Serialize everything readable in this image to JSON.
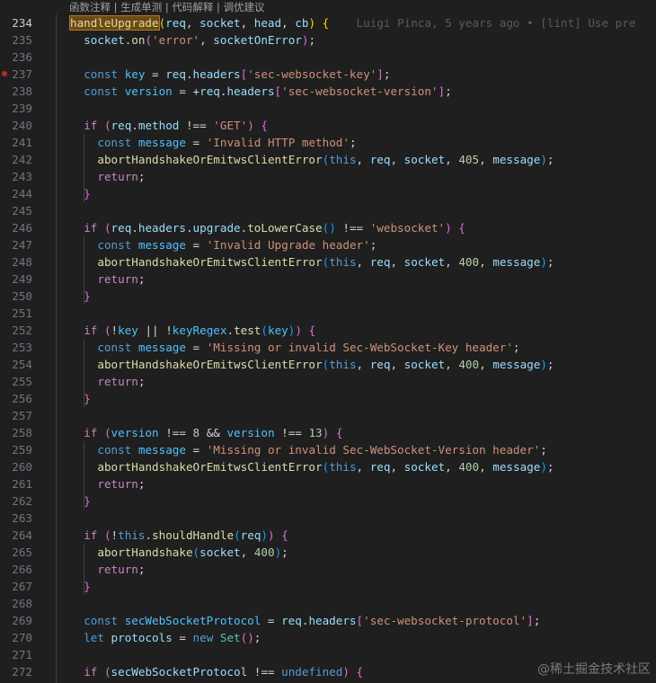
{
  "codelens": [
    {
      "label": "函数注释"
    },
    {
      "label": "生成单测"
    },
    {
      "label": "代码解释"
    },
    {
      "label": "调优建议"
    }
  ],
  "codelens_separator": " | ",
  "watermark": "@稀土掘金技术社区",
  "active_line": 234,
  "breakpoint_line": 237,
  "lines": [
    {
      "n": "234",
      "indent": 0,
      "blame": "Luigi Pinca, 5 years ago • [lint] Use pre",
      "tokens": [
        [
          "handleUpgrade",
          "fn hl"
        ],
        [
          "(",
          "br1"
        ],
        [
          "req",
          "var"
        ],
        [
          ", ",
          "plain"
        ],
        [
          "socket",
          "var"
        ],
        [
          ", ",
          "plain"
        ],
        [
          "head",
          "var"
        ],
        [
          ", ",
          "plain"
        ],
        [
          "cb",
          "var"
        ],
        [
          ")",
          "br1"
        ],
        [
          " {",
          "br1"
        ]
      ]
    },
    {
      "n": "235",
      "indent": 1,
      "tokens": [
        [
          "socket",
          "var"
        ],
        [
          ".",
          "plain"
        ],
        [
          "on",
          "fn"
        ],
        [
          "(",
          "br2"
        ],
        [
          "'error'",
          "str"
        ],
        [
          ", ",
          "plain"
        ],
        [
          "socketOnError",
          "var"
        ],
        [
          ")",
          "br2"
        ],
        [
          ";",
          "plain"
        ]
      ]
    },
    {
      "n": "236",
      "indent": 0,
      "tokens": []
    },
    {
      "n": "237",
      "indent": 1,
      "tokens": [
        [
          "const ",
          "kw"
        ],
        [
          "key",
          "reg"
        ],
        [
          " = ",
          "plain"
        ],
        [
          "req",
          "var"
        ],
        [
          ".",
          "plain"
        ],
        [
          "headers",
          "var"
        ],
        [
          "[",
          "br2"
        ],
        [
          "'sec-websocket-key'",
          "str"
        ],
        [
          "]",
          "br2"
        ],
        [
          ";",
          "plain"
        ]
      ]
    },
    {
      "n": "238",
      "indent": 1,
      "tokens": [
        [
          "const ",
          "kw"
        ],
        [
          "version",
          "reg"
        ],
        [
          " = +",
          "plain"
        ],
        [
          "req",
          "var"
        ],
        [
          ".",
          "plain"
        ],
        [
          "headers",
          "var"
        ],
        [
          "[",
          "br2"
        ],
        [
          "'sec-websocket-version'",
          "str"
        ],
        [
          "]",
          "br2"
        ],
        [
          ";",
          "plain"
        ]
      ]
    },
    {
      "n": "239",
      "indent": 0,
      "tokens": []
    },
    {
      "n": "240",
      "indent": 1,
      "tokens": [
        [
          "if ",
          "ctl"
        ],
        [
          "(",
          "br2"
        ],
        [
          "req",
          "var"
        ],
        [
          ".",
          "plain"
        ],
        [
          "method",
          "var"
        ],
        [
          " !== ",
          "plain"
        ],
        [
          "'GET'",
          "str"
        ],
        [
          ")",
          "br2"
        ],
        [
          " {",
          "br2"
        ]
      ]
    },
    {
      "n": "241",
      "indent": 2,
      "tokens": [
        [
          "const ",
          "kw"
        ],
        [
          "message",
          "reg"
        ],
        [
          " = ",
          "plain"
        ],
        [
          "'Invalid HTTP method'",
          "str"
        ],
        [
          ";",
          "plain"
        ]
      ]
    },
    {
      "n": "242",
      "indent": 2,
      "tokens": [
        [
          "abortHandshakeOrEmitwsClientError",
          "fn"
        ],
        [
          "(",
          "br3"
        ],
        [
          "this",
          "kw"
        ],
        [
          ", ",
          "plain"
        ],
        [
          "req",
          "var"
        ],
        [
          ", ",
          "plain"
        ],
        [
          "socket",
          "var"
        ],
        [
          ", ",
          "plain"
        ],
        [
          "405",
          "num"
        ],
        [
          ", ",
          "plain"
        ],
        [
          "message",
          "var"
        ],
        [
          ")",
          "br3"
        ],
        [
          ";",
          "plain"
        ]
      ]
    },
    {
      "n": "243",
      "indent": 2,
      "tokens": [
        [
          "return",
          "ctl"
        ],
        [
          ";",
          "plain"
        ]
      ]
    },
    {
      "n": "244",
      "indent": 1,
      "tokens": [
        [
          "}",
          "br2"
        ]
      ]
    },
    {
      "n": "245",
      "indent": 0,
      "tokens": []
    },
    {
      "n": "246",
      "indent": 1,
      "tokens": [
        [
          "if ",
          "ctl"
        ],
        [
          "(",
          "br2"
        ],
        [
          "req",
          "var"
        ],
        [
          ".",
          "plain"
        ],
        [
          "headers",
          "var"
        ],
        [
          ".",
          "plain"
        ],
        [
          "upgrade",
          "var"
        ],
        [
          ".",
          "plain"
        ],
        [
          "toLowerCase",
          "fn"
        ],
        [
          "()",
          "br3"
        ],
        [
          " !== ",
          "plain"
        ],
        [
          "'websocket'",
          "str"
        ],
        [
          ")",
          "br2"
        ],
        [
          " {",
          "br2"
        ]
      ]
    },
    {
      "n": "247",
      "indent": 2,
      "tokens": [
        [
          "const ",
          "kw"
        ],
        [
          "message",
          "reg"
        ],
        [
          " = ",
          "plain"
        ],
        [
          "'Invalid Upgrade header'",
          "str"
        ],
        [
          ";",
          "plain"
        ]
      ]
    },
    {
      "n": "248",
      "indent": 2,
      "tokens": [
        [
          "abortHandshakeOrEmitwsClientError",
          "fn"
        ],
        [
          "(",
          "br3"
        ],
        [
          "this",
          "kw"
        ],
        [
          ", ",
          "plain"
        ],
        [
          "req",
          "var"
        ],
        [
          ", ",
          "plain"
        ],
        [
          "socket",
          "var"
        ],
        [
          ", ",
          "plain"
        ],
        [
          "400",
          "num"
        ],
        [
          ", ",
          "plain"
        ],
        [
          "message",
          "var"
        ],
        [
          ")",
          "br3"
        ],
        [
          ";",
          "plain"
        ]
      ]
    },
    {
      "n": "249",
      "indent": 2,
      "tokens": [
        [
          "return",
          "ctl"
        ],
        [
          ";",
          "plain"
        ]
      ]
    },
    {
      "n": "250",
      "indent": 1,
      "tokens": [
        [
          "}",
          "br2"
        ]
      ]
    },
    {
      "n": "251",
      "indent": 0,
      "tokens": []
    },
    {
      "n": "252",
      "indent": 1,
      "tokens": [
        [
          "if ",
          "ctl"
        ],
        [
          "(",
          "br2"
        ],
        [
          "!",
          "plain"
        ],
        [
          "key",
          "reg"
        ],
        [
          " || !",
          "plain"
        ],
        [
          "keyRegex",
          "reg"
        ],
        [
          ".",
          "plain"
        ],
        [
          "test",
          "fn"
        ],
        [
          "(",
          "br3"
        ],
        [
          "key",
          "reg"
        ],
        [
          ")",
          "br3"
        ],
        [
          ")",
          "br2"
        ],
        [
          " {",
          "br2"
        ]
      ]
    },
    {
      "n": "253",
      "indent": 2,
      "tokens": [
        [
          "const ",
          "kw"
        ],
        [
          "message",
          "reg"
        ],
        [
          " = ",
          "plain"
        ],
        [
          "'Missing or invalid Sec-WebSocket-Key header'",
          "str"
        ],
        [
          ";",
          "plain"
        ]
      ]
    },
    {
      "n": "254",
      "indent": 2,
      "tokens": [
        [
          "abortHandshakeOrEmitwsClientError",
          "fn"
        ],
        [
          "(",
          "br3"
        ],
        [
          "this",
          "kw"
        ],
        [
          ", ",
          "plain"
        ],
        [
          "req",
          "var"
        ],
        [
          ", ",
          "plain"
        ],
        [
          "socket",
          "var"
        ],
        [
          ", ",
          "plain"
        ],
        [
          "400",
          "num"
        ],
        [
          ", ",
          "plain"
        ],
        [
          "message",
          "var"
        ],
        [
          ")",
          "br3"
        ],
        [
          ";",
          "plain"
        ]
      ]
    },
    {
      "n": "255",
      "indent": 2,
      "tokens": [
        [
          "return",
          "ctl"
        ],
        [
          ";",
          "plain"
        ]
      ]
    },
    {
      "n": "256",
      "indent": 1,
      "tokens": [
        [
          "}",
          "br2"
        ]
      ]
    },
    {
      "n": "257",
      "indent": 0,
      "tokens": []
    },
    {
      "n": "258",
      "indent": 1,
      "tokens": [
        [
          "if ",
          "ctl"
        ],
        [
          "(",
          "br2"
        ],
        [
          "version",
          "reg"
        ],
        [
          " !== ",
          "plain"
        ],
        [
          "8",
          "num"
        ],
        [
          " && ",
          "plain"
        ],
        [
          "version",
          "reg"
        ],
        [
          " !== ",
          "plain"
        ],
        [
          "13",
          "num"
        ],
        [
          ")",
          "br2"
        ],
        [
          " {",
          "br2"
        ]
      ]
    },
    {
      "n": "259",
      "indent": 2,
      "tokens": [
        [
          "const ",
          "kw"
        ],
        [
          "message",
          "reg"
        ],
        [
          " = ",
          "plain"
        ],
        [
          "'Missing or invalid Sec-WebSocket-Version header'",
          "str"
        ],
        [
          ";",
          "plain"
        ]
      ]
    },
    {
      "n": "260",
      "indent": 2,
      "tokens": [
        [
          "abortHandshakeOrEmitwsClientError",
          "fn"
        ],
        [
          "(",
          "br3"
        ],
        [
          "this",
          "kw"
        ],
        [
          ", ",
          "plain"
        ],
        [
          "req",
          "var"
        ],
        [
          ", ",
          "plain"
        ],
        [
          "socket",
          "var"
        ],
        [
          ", ",
          "plain"
        ],
        [
          "400",
          "num"
        ],
        [
          ", ",
          "plain"
        ],
        [
          "message",
          "var"
        ],
        [
          ")",
          "br3"
        ],
        [
          ";",
          "plain"
        ]
      ]
    },
    {
      "n": "261",
      "indent": 2,
      "tokens": [
        [
          "return",
          "ctl"
        ],
        [
          ";",
          "plain"
        ]
      ]
    },
    {
      "n": "262",
      "indent": 1,
      "tokens": [
        [
          "}",
          "br2"
        ]
      ]
    },
    {
      "n": "263",
      "indent": 0,
      "tokens": []
    },
    {
      "n": "264",
      "indent": 1,
      "tokens": [
        [
          "if ",
          "ctl"
        ],
        [
          "(",
          "br2"
        ],
        [
          "!",
          "plain"
        ],
        [
          "this",
          "kw"
        ],
        [
          ".",
          "plain"
        ],
        [
          "shouldHandle",
          "fn"
        ],
        [
          "(",
          "br3"
        ],
        [
          "req",
          "var"
        ],
        [
          ")",
          "br3"
        ],
        [
          ")",
          "br2"
        ],
        [
          " {",
          "br2"
        ]
      ]
    },
    {
      "n": "265",
      "indent": 2,
      "tokens": [
        [
          "abortHandshake",
          "fn"
        ],
        [
          "(",
          "br3"
        ],
        [
          "socket",
          "var"
        ],
        [
          ", ",
          "plain"
        ],
        [
          "400",
          "num"
        ],
        [
          ")",
          "br3"
        ],
        [
          ";",
          "plain"
        ]
      ]
    },
    {
      "n": "266",
      "indent": 2,
      "tokens": [
        [
          "return",
          "ctl"
        ],
        [
          ";",
          "plain"
        ]
      ]
    },
    {
      "n": "267",
      "indent": 1,
      "tokens": [
        [
          "}",
          "br2"
        ]
      ]
    },
    {
      "n": "268",
      "indent": 0,
      "tokens": []
    },
    {
      "n": "269",
      "indent": 1,
      "tokens": [
        [
          "const ",
          "kw"
        ],
        [
          "secWebSocketProtocol",
          "reg"
        ],
        [
          " = ",
          "plain"
        ],
        [
          "req",
          "var"
        ],
        [
          ".",
          "plain"
        ],
        [
          "headers",
          "var"
        ],
        [
          "[",
          "br2"
        ],
        [
          "'sec-websocket-protocol'",
          "str"
        ],
        [
          "]",
          "br2"
        ],
        [
          ";",
          "plain"
        ]
      ]
    },
    {
      "n": "270",
      "indent": 1,
      "tokens": [
        [
          "let ",
          "kw"
        ],
        [
          "protocols",
          "var"
        ],
        [
          " = ",
          "plain"
        ],
        [
          "new ",
          "kw"
        ],
        [
          "Set",
          "cls"
        ],
        [
          "()",
          "br2"
        ],
        [
          ";",
          "plain"
        ]
      ]
    },
    {
      "n": "271",
      "indent": 0,
      "tokens": []
    },
    {
      "n": "272",
      "indent": 1,
      "tokens": [
        [
          "if ",
          "ctl"
        ],
        [
          "(",
          "br2"
        ],
        [
          "secWebSocketProtocol",
          "var"
        ],
        [
          " !== ",
          "plain"
        ],
        [
          "undefined",
          "kw"
        ],
        [
          ")",
          "br2"
        ],
        [
          " {",
          "br2"
        ]
      ]
    }
  ]
}
